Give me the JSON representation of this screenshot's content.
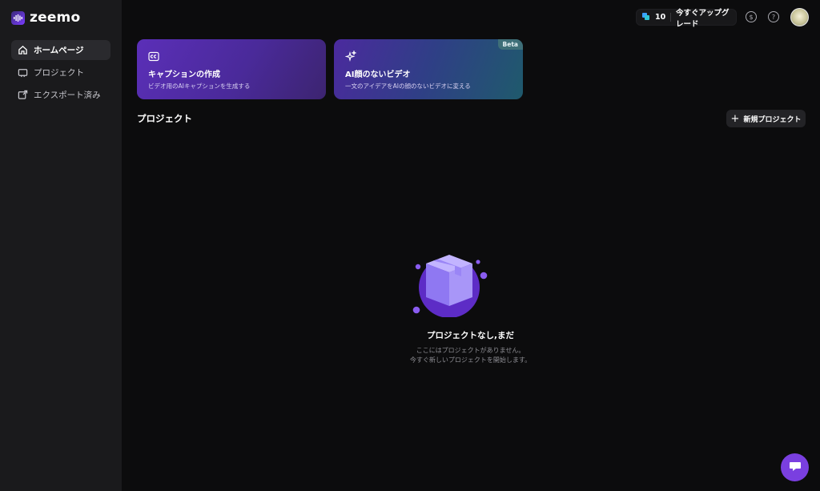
{
  "app": {
    "name": "zeemo"
  },
  "sidebar": {
    "items": [
      {
        "label": "ホームページ",
        "icon": "home-icon",
        "active": true
      },
      {
        "label": "プロジェクト",
        "icon": "projects-icon",
        "active": false
      },
      {
        "label": "エクスポート済み",
        "icon": "export-icon",
        "active": false
      }
    ]
  },
  "topbar": {
    "credits": "10",
    "upgrade_label": "今すぐアップグレード",
    "icons": [
      "subscription-icon",
      "help-icon"
    ]
  },
  "cards": [
    {
      "title": "キャプションの作成",
      "subtitle": "ビデオ用のAIキャプションを生成する",
      "icon": "cc-icon"
    },
    {
      "title": "AI顔のないビデオ",
      "subtitle": "一文のアイデアをAIの顔のないビデオに変える",
      "icon": "sparkle-icon",
      "badge": "Beta"
    }
  ],
  "projects": {
    "title": "プロジェクト",
    "new_label": "新規プロジェクト",
    "empty": {
      "title": "プロジェクトなし,まだ",
      "line1": "ここにはプロジェクトがありません。",
      "line2": "今すぐ新しいプロジェクトを開始します。"
    }
  },
  "colors": {
    "accent": "#7a3fe0",
    "background": "#0c0c0d",
    "sidebar": "#1a1a1c"
  }
}
